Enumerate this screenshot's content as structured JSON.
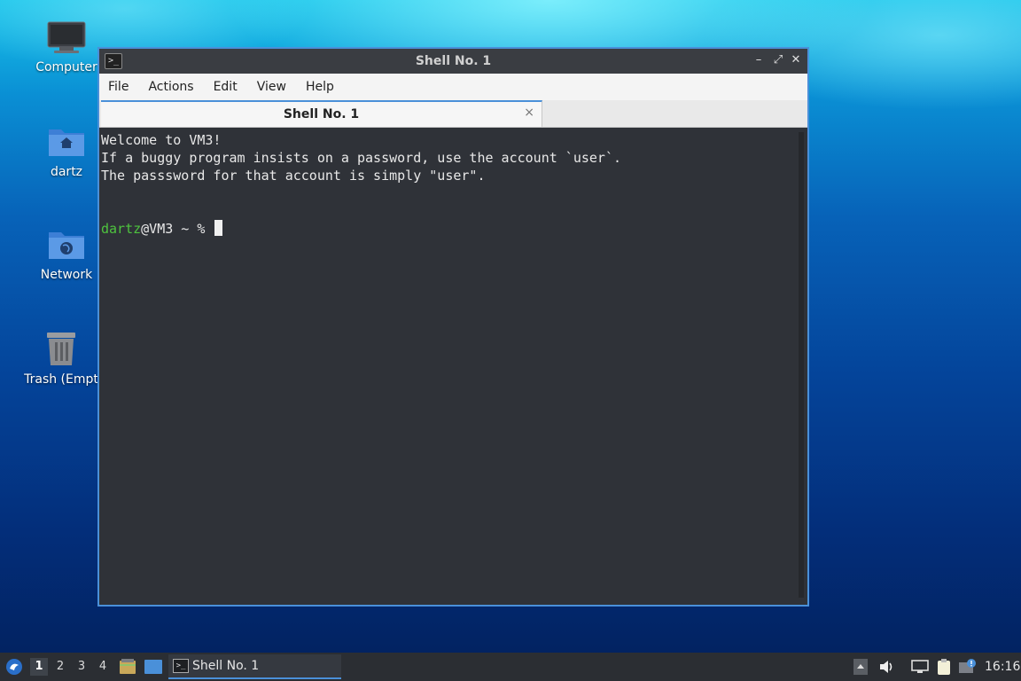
{
  "desktop": {
    "icons": [
      {
        "label": "Computer"
      },
      {
        "label": "dartz"
      },
      {
        "label": "Network"
      },
      {
        "label": "Trash (Empt"
      }
    ]
  },
  "window": {
    "title": "Shell No. 1",
    "menu": [
      "File",
      "Actions",
      "Edit",
      "View",
      "Help"
    ],
    "tab": {
      "label": "Shell No. 1",
      "close": "×"
    },
    "terminal": {
      "lines": [
        "Welcome to VM3!",
        "If a buggy program insists on a password, use the account `user`.",
        "The passsword for that account is simply \"user\"."
      ],
      "prompt_user": "dartz",
      "prompt_rest": "@VM3 ~ % "
    }
  },
  "taskbar": {
    "workspaces": [
      "1",
      "2",
      "3",
      "4"
    ],
    "active_workspace": "1",
    "task_label": "Shell No. 1",
    "clock": "16:16"
  },
  "colors": {
    "accent": "#4a90d9",
    "prompt_user": "#4ec33e",
    "terminal_bg": "#2f3238"
  }
}
